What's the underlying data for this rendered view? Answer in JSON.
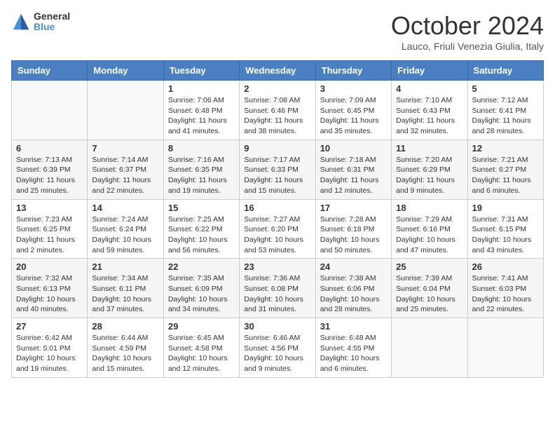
{
  "header": {
    "logo_general": "General",
    "logo_blue": "Blue",
    "month_title": "October 2024",
    "location": "Lauco, Friuli Venezia Giulia, Italy"
  },
  "days_of_week": [
    "Sunday",
    "Monday",
    "Tuesday",
    "Wednesday",
    "Thursday",
    "Friday",
    "Saturday"
  ],
  "weeks": [
    [
      null,
      null,
      {
        "num": "1",
        "sunrise": "7:06 AM",
        "sunset": "6:48 PM",
        "daylight": "11 hours and 41 minutes."
      },
      {
        "num": "2",
        "sunrise": "7:08 AM",
        "sunset": "6:46 PM",
        "daylight": "11 hours and 38 minutes."
      },
      {
        "num": "3",
        "sunrise": "7:09 AM",
        "sunset": "6:45 PM",
        "daylight": "11 hours and 35 minutes."
      },
      {
        "num": "4",
        "sunrise": "7:10 AM",
        "sunset": "6:43 PM",
        "daylight": "11 hours and 32 minutes."
      },
      {
        "num": "5",
        "sunrise": "7:12 AM",
        "sunset": "6:41 PM",
        "daylight": "11 hours and 28 minutes."
      }
    ],
    [
      {
        "num": "6",
        "sunrise": "7:13 AM",
        "sunset": "6:39 PM",
        "daylight": "11 hours and 25 minutes."
      },
      {
        "num": "7",
        "sunrise": "7:14 AM",
        "sunset": "6:37 PM",
        "daylight": "11 hours and 22 minutes."
      },
      {
        "num": "8",
        "sunrise": "7:16 AM",
        "sunset": "6:35 PM",
        "daylight": "11 hours and 19 minutes."
      },
      {
        "num": "9",
        "sunrise": "7:17 AM",
        "sunset": "6:33 PM",
        "daylight": "11 hours and 15 minutes."
      },
      {
        "num": "10",
        "sunrise": "7:18 AM",
        "sunset": "6:31 PM",
        "daylight": "11 hours and 12 minutes."
      },
      {
        "num": "11",
        "sunrise": "7:20 AM",
        "sunset": "6:29 PM",
        "daylight": "11 hours and 9 minutes."
      },
      {
        "num": "12",
        "sunrise": "7:21 AM",
        "sunset": "6:27 PM",
        "daylight": "11 hours and 6 minutes."
      }
    ],
    [
      {
        "num": "13",
        "sunrise": "7:23 AM",
        "sunset": "6:25 PM",
        "daylight": "11 hours and 2 minutes."
      },
      {
        "num": "14",
        "sunrise": "7:24 AM",
        "sunset": "6:24 PM",
        "daylight": "10 hours and 59 minutes."
      },
      {
        "num": "15",
        "sunrise": "7:25 AM",
        "sunset": "6:22 PM",
        "daylight": "10 hours and 56 minutes."
      },
      {
        "num": "16",
        "sunrise": "7:27 AM",
        "sunset": "6:20 PM",
        "daylight": "10 hours and 53 minutes."
      },
      {
        "num": "17",
        "sunrise": "7:28 AM",
        "sunset": "6:18 PM",
        "daylight": "10 hours and 50 minutes."
      },
      {
        "num": "18",
        "sunrise": "7:29 AM",
        "sunset": "6:16 PM",
        "daylight": "10 hours and 47 minutes."
      },
      {
        "num": "19",
        "sunrise": "7:31 AM",
        "sunset": "6:15 PM",
        "daylight": "10 hours and 43 minutes."
      }
    ],
    [
      {
        "num": "20",
        "sunrise": "7:32 AM",
        "sunset": "6:13 PM",
        "daylight": "10 hours and 40 minutes."
      },
      {
        "num": "21",
        "sunrise": "7:34 AM",
        "sunset": "6:11 PM",
        "daylight": "10 hours and 37 minutes."
      },
      {
        "num": "22",
        "sunrise": "7:35 AM",
        "sunset": "6:09 PM",
        "daylight": "10 hours and 34 minutes."
      },
      {
        "num": "23",
        "sunrise": "7:36 AM",
        "sunset": "6:08 PM",
        "daylight": "10 hours and 31 minutes."
      },
      {
        "num": "24",
        "sunrise": "7:38 AM",
        "sunset": "6:06 PM",
        "daylight": "10 hours and 28 minutes."
      },
      {
        "num": "25",
        "sunrise": "7:39 AM",
        "sunset": "6:04 PM",
        "daylight": "10 hours and 25 minutes."
      },
      {
        "num": "26",
        "sunrise": "7:41 AM",
        "sunset": "6:03 PM",
        "daylight": "10 hours and 22 minutes."
      }
    ],
    [
      {
        "num": "27",
        "sunrise": "6:42 AM",
        "sunset": "5:01 PM",
        "daylight": "10 hours and 19 minutes."
      },
      {
        "num": "28",
        "sunrise": "6:44 AM",
        "sunset": "4:59 PM",
        "daylight": "10 hours and 15 minutes."
      },
      {
        "num": "29",
        "sunrise": "6:45 AM",
        "sunset": "4:58 PM",
        "daylight": "10 hours and 12 minutes."
      },
      {
        "num": "30",
        "sunrise": "6:46 AM",
        "sunset": "4:56 PM",
        "daylight": "10 hours and 9 minutes."
      },
      {
        "num": "31",
        "sunrise": "6:48 AM",
        "sunset": "4:55 PM",
        "daylight": "10 hours and 6 minutes."
      },
      null,
      null
    ]
  ],
  "labels": {
    "sunrise": "Sunrise:",
    "sunset": "Sunset:",
    "daylight": "Daylight:"
  }
}
